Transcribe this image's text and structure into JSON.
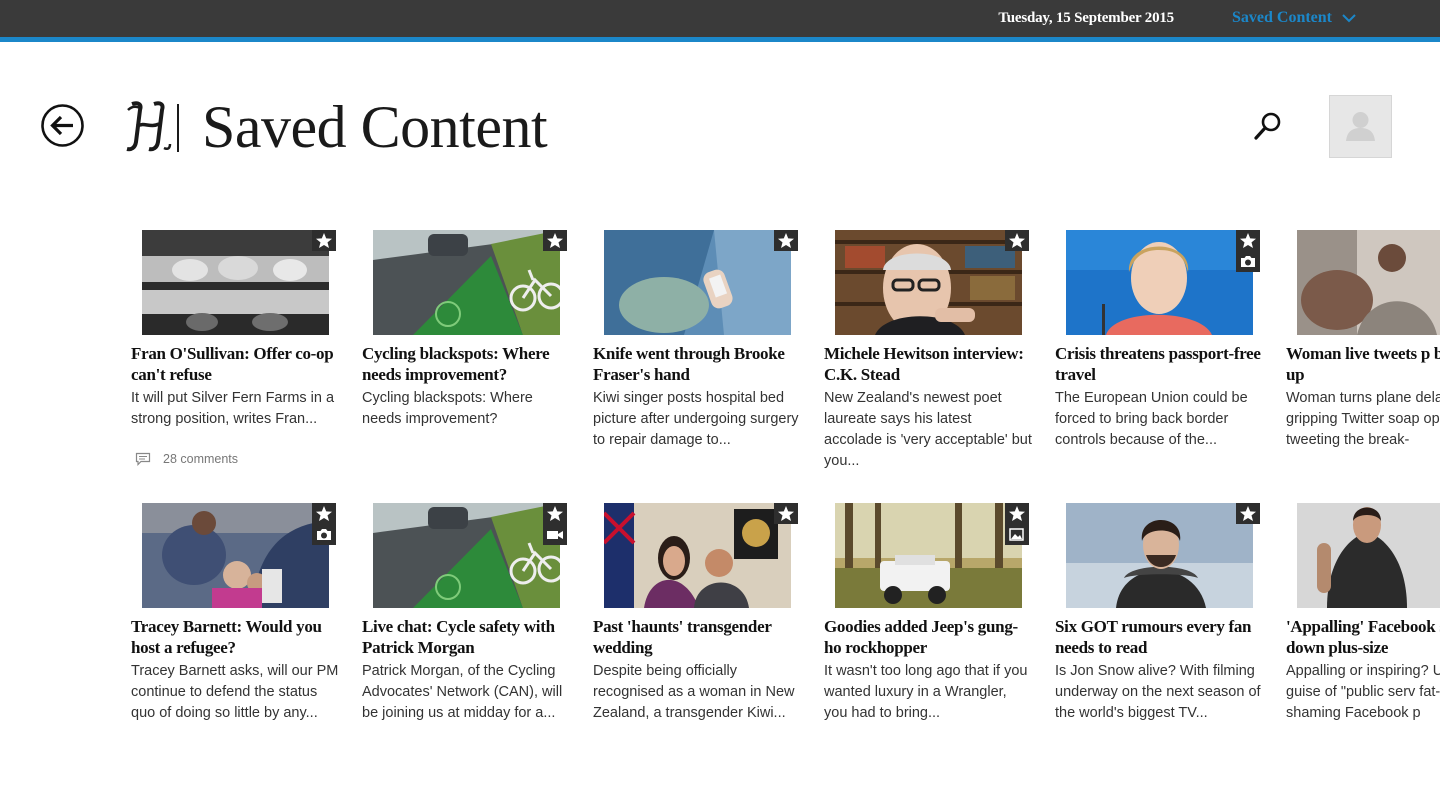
{
  "topbar": {
    "date": "Tuesday, 15 September 2015",
    "menu_label": "Saved Content",
    "accent": "#1b87c9"
  },
  "header": {
    "title": "Saved Content",
    "back_icon": "back-arrow-icon",
    "logo": "nz-herald-h-logo",
    "search_icon": "search-icon",
    "avatar_icon": "user-avatar-icon"
  },
  "articles": [
    {
      "headline": "Fran O'Sullivan: Offer co-op can't refuse",
      "summary": "It will put Silver Fern Farms in a strong position, writes Fran...",
      "comments": "28 comments",
      "badge": [
        "star"
      ]
    },
    {
      "headline": "Cycling blackspots: Where needs improvement?",
      "summary": "Cycling blackspots: Where needs improvement?",
      "badge": [
        "star"
      ]
    },
    {
      "headline": "Knife went through Brooke Fraser's hand",
      "summary": "Kiwi singer posts hospital bed picture after undergoing surgery to repair damage to...",
      "badge": [
        "star"
      ]
    },
    {
      "headline": "Michele Hewitson interview: C.K. Stead",
      "summary": "New Zealand's newest poet laureate says his latest accolade is 'very acceptable' but you...",
      "badge": [
        "star"
      ]
    },
    {
      "headline": "Crisis threatens passport-free travel",
      "summary": "The European Union could be forced to bring back border controls because of the...",
      "badge": [
        "star",
        "camera"
      ]
    },
    {
      "headline": "Woman live tweets p break-up",
      "summary": "Woman turns plane dela gripping Twitter soap op live-tweeting the break-",
      "badge": []
    },
    {
      "headline": "Tracey Barnett: Would you host a refugee?",
      "summary": "Tracey Barnett asks, will our PM continue to defend the status quo of doing so little by any...",
      "badge": [
        "star",
        "camera"
      ]
    },
    {
      "headline": "Live chat: Cycle safety with Patrick Morgan",
      "summary": "Patrick Morgan, of the Cycling Advocates' Network (CAN), will be joining us at midday  for a...",
      "badge": [
        "star",
        "video"
      ]
    },
    {
      "headline": "Past 'haunts' transgender wedding",
      "summary": "Despite being officially recognised as a woman in New Zealand, a transgender Kiwi...",
      "badge": [
        "star"
      ]
    },
    {
      "headline": "Goodies added Jeep's gung-ho rockhopper",
      "summary": "It wasn't too long ago that if you wanted luxury in a Wrangler, you had to bring...",
      "badge": [
        "star",
        "gallery"
      ]
    },
    {
      "headline": "Six GOT rumours every fan needs to read",
      "summary": "Is Jon Snow alive? With filming underway on the next season of the world's biggest TV...",
      "badge": [
        "star"
      ]
    },
    {
      "headline": "'Appalling' Facebook slims down plus-size",
      "summary": "Appalling or inspiring? U the guise of \"public serv fat-shaming Facebook p",
      "badge": []
    }
  ]
}
